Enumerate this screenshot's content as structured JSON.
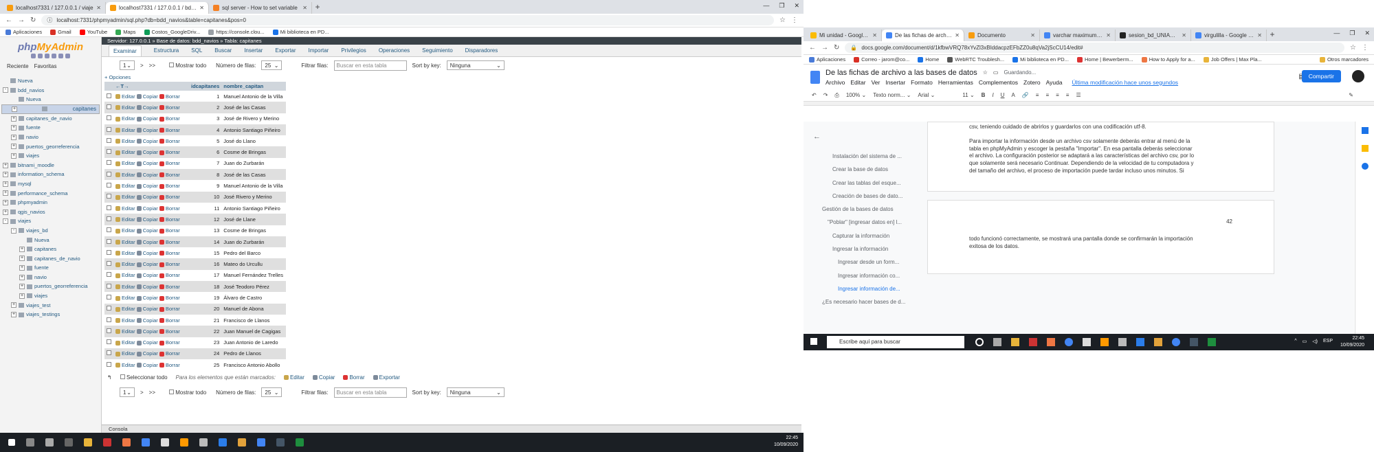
{
  "left_browser": {
    "tabs": [
      {
        "title": "localhost7331 / 127.0.0.1 / viaje",
        "color": "#f89c0e",
        "active": false
      },
      {
        "title": "localhost7331 / 127.0.0.1 / bdd_",
        "color": "#f89c0e",
        "active": true
      },
      {
        "title": "sql server - How to set variable",
        "color": "#f48024",
        "active": false
      }
    ],
    "url": "localhost:7331/phpmyadmin/sql.php?db=bdd_navios&table=capitanes&pos=0",
    "bookmarks": [
      "Aplicaciones",
      "Gmail",
      "YouTube",
      "Maps",
      "Costos_GoogleDriv...",
      "https://console.clou...",
      "Mi biblioteca en PD..."
    ]
  },
  "phpmyadmin": {
    "logo_php": "php",
    "logo_my": "MyAdmin",
    "nav_tabs": [
      "Reciente",
      "Favoritas"
    ],
    "tree": [
      {
        "label": "Nueva",
        "level": 0,
        "toggle": ""
      },
      {
        "label": "bdd_navios",
        "level": 0,
        "toggle": "-"
      },
      {
        "label": "Nueva",
        "level": 1,
        "toggle": ""
      },
      {
        "label": "capitanes",
        "level": 1,
        "toggle": "+",
        "selected": true
      },
      {
        "label": "capitanes_de_navio",
        "level": 1,
        "toggle": "+"
      },
      {
        "label": "fuente",
        "level": 1,
        "toggle": "+"
      },
      {
        "label": "navio",
        "level": 1,
        "toggle": "+"
      },
      {
        "label": "puertos_georreferencia",
        "level": 1,
        "toggle": "+"
      },
      {
        "label": "viajes",
        "level": 1,
        "toggle": "+"
      },
      {
        "label": "bitnami_moodle",
        "level": 0,
        "toggle": "+"
      },
      {
        "label": "information_schema",
        "level": 0,
        "toggle": "+"
      },
      {
        "label": "mysql",
        "level": 0,
        "toggle": "+"
      },
      {
        "label": "performance_schema",
        "level": 0,
        "toggle": "+"
      },
      {
        "label": "phpmyadmin",
        "level": 0,
        "toggle": "+"
      },
      {
        "label": "qgis_navios",
        "level": 0,
        "toggle": "+"
      },
      {
        "label": "viajes",
        "level": 0,
        "toggle": "-"
      },
      {
        "label": "viajes_bd",
        "level": 1,
        "toggle": "-"
      },
      {
        "label": "Nueva",
        "level": 2,
        "toggle": ""
      },
      {
        "label": "capitanes",
        "level": 2,
        "toggle": "+"
      },
      {
        "label": "capitanes_de_navio",
        "level": 2,
        "toggle": "+"
      },
      {
        "label": "fuente",
        "level": 2,
        "toggle": "+"
      },
      {
        "label": "navio",
        "level": 2,
        "toggle": "+"
      },
      {
        "label": "puertos_georreferencia",
        "level": 2,
        "toggle": "+"
      },
      {
        "label": "viajes",
        "level": 2,
        "toggle": "+"
      },
      {
        "label": "viajes_test",
        "level": 1,
        "toggle": "+"
      },
      {
        "label": "viajes_testings",
        "level": 1,
        "toggle": "+"
      }
    ],
    "breadcrumb": "Servidor: 127.0.0.1 » Base de datos: bdd_navios » Tabla: capitanes",
    "menu": [
      "Examinar",
      "Estructura",
      "SQL",
      "Buscar",
      "Insertar",
      "Exportar",
      "Importar",
      "Privilegios",
      "Operaciones",
      "Seguimiento",
      "Disparadores"
    ],
    "controls": {
      "page": "1",
      "next": ">",
      "last": ">>",
      "show_all": "Mostrar todo",
      "rows_label": "Número de filas:",
      "rows_value": "25",
      "filter_label": "Filtrar filas:",
      "filter_placeholder": "Buscar en esta tabla",
      "sort_label": "Sort by key:",
      "sort_value": "Ninguna"
    },
    "options_link": "+ Opciones",
    "columns": [
      "idcapitanes",
      "nombre_capitan"
    ],
    "actions": {
      "edit": "Editar",
      "copy": "Copiar",
      "delete": "Borrar"
    },
    "rows": [
      {
        "id": "1",
        "name": "Manuel Antonio de la Villa"
      },
      {
        "id": "2",
        "name": "José de las Casas"
      },
      {
        "id": "3",
        "name": "José de Rivero y Merino"
      },
      {
        "id": "4",
        "name": "Antonio Santiago Piñeiro"
      },
      {
        "id": "5",
        "name": "José do Llano"
      },
      {
        "id": "6",
        "name": "Cosme de Bringas"
      },
      {
        "id": "7",
        "name": "Juan do Zurbarán"
      },
      {
        "id": "8",
        "name": "José de las Casas"
      },
      {
        "id": "9",
        "name": "Manuel Antonio de la Villa"
      },
      {
        "id": "10",
        "name": "José Rivero y Merino"
      },
      {
        "id": "11",
        "name": "Antonio Santiago Piñeiro"
      },
      {
        "id": "12",
        "name": "José de Llane"
      },
      {
        "id": "13",
        "name": "Cosme de Bringas"
      },
      {
        "id": "14",
        "name": "Juan do Zurbarán"
      },
      {
        "id": "15",
        "name": "Pedro del Barco"
      },
      {
        "id": "16",
        "name": "Mateo do Urcullu"
      },
      {
        "id": "17",
        "name": "Manuel Fernández Trelles"
      },
      {
        "id": "18",
        "name": "José Teodoro Pérez"
      },
      {
        "id": "19",
        "name": "Álvaro de Castro"
      },
      {
        "id": "20",
        "name": "Manuel de Abona"
      },
      {
        "id": "21",
        "name": "Francisco de Llanos"
      },
      {
        "id": "22",
        "name": "Juan Manuel de Cagigas"
      },
      {
        "id": "23",
        "name": "Juan Antonio de Laredo"
      },
      {
        "id": "24",
        "name": "Pedro de Llanos"
      },
      {
        "id": "25",
        "name": "Francisco Antonio Abollo"
      }
    ],
    "bottom": {
      "select_all": "Seleccionar todo",
      "for_selected": "Para los elementos que están marcados:",
      "edit": "Editar",
      "copy": "Copiar",
      "delete": "Borrar",
      "export": "Exportar"
    },
    "console": "Consola"
  },
  "taskbar_left": {
    "time": "22:45",
    "date": "10/09/2020"
  },
  "right_browser": {
    "tabs": [
      "Mi unidad - Google Dr",
      "De las fichas de archivo",
      "Documento",
      "varchar maximum leng",
      "sesion_bd_UNIANDES",
      "virgulilla - Google Sea"
    ],
    "url": "docs.google.com/document/d/1kfbwVRQ78xYvZl3xBIddacpzEFbZZ0u8qVa2jScCU14/edit#",
    "bookmarks": [
      "Aplicaciones",
      "Correo - jarom@co...",
      "Home",
      "WebRTC Troublesh...",
      "Mi biblioteca en PD...",
      "Home | Bewerberm...",
      "How to Apply for a...",
      "Job Offers | Max Pla...",
      "Otros marcadores"
    ]
  },
  "gdoc": {
    "title": "De las fichas de archivo a las bases de datos",
    "saving": "Guardando...",
    "menus": [
      "Archivo",
      "Editar",
      "Ver",
      "Insertar",
      "Formato",
      "Herramientas",
      "Complementos",
      "Zotero",
      "Ayuda"
    ],
    "last_edit": "Última modificación hace unos segundos",
    "share": "Compartir",
    "toolbar": {
      "zoom": "100%",
      "style": "Texto norm...",
      "font": "Arial",
      "size": "11"
    },
    "outline": [
      {
        "text": "Instalación del sistema de ...",
        "active": false
      },
      {
        "text": "Crear la base de datos",
        "active": false
      },
      {
        "text": "Crear las tablas del esque...",
        "active": false
      },
      {
        "text": "Creación de bases de dato...",
        "active": false
      },
      {
        "text": "Gestión de la bases de datos",
        "active": false
      },
      {
        "text": "\"Poblar\" [ingresar datos en] l...",
        "active": false
      },
      {
        "text": "Capturar la información",
        "active": false
      },
      {
        "text": "Ingresar la información",
        "active": false
      },
      {
        "text": "Ingresar desde un form...",
        "active": false
      },
      {
        "text": "Ingresar información co...",
        "active": false
      },
      {
        "text": "Ingresar información de...",
        "active": true
      },
      {
        "text": "¿Es necesario hacer bases de d...",
        "active": false
      }
    ],
    "page1_lines": [
      "csv, teniendo cuidado de abrirlos y guardarlos con una codificación utf-8.",
      "",
      "Para importar la información desde un archivo csv solamente deberás entrar al menú de la",
      "tabla en phpMyAdmin y escoger la pestaña \"Importar\". En esa pantalla deberás seleccionar",
      "el archivo. La configuración posterior se adaptará a las características del archivo csv, por lo",
      "que solamente será necesario Continuar. Dependiendo de la velocidad de tu computadora y",
      "del tamaño del archivo, el proceso de importación puede tardar incluso unos minutos. Si"
    ],
    "page_number": "42",
    "page2_lines": [
      "todo funcionó correctamente, se mostrará una pantalla donde se confirmarán la importación",
      "exitosa de los datos."
    ]
  },
  "taskbar_right": {
    "search_placeholder": "Escribe aquí para buscar",
    "lang": "ESP",
    "time": "22:45",
    "date": "10/09/2020"
  }
}
